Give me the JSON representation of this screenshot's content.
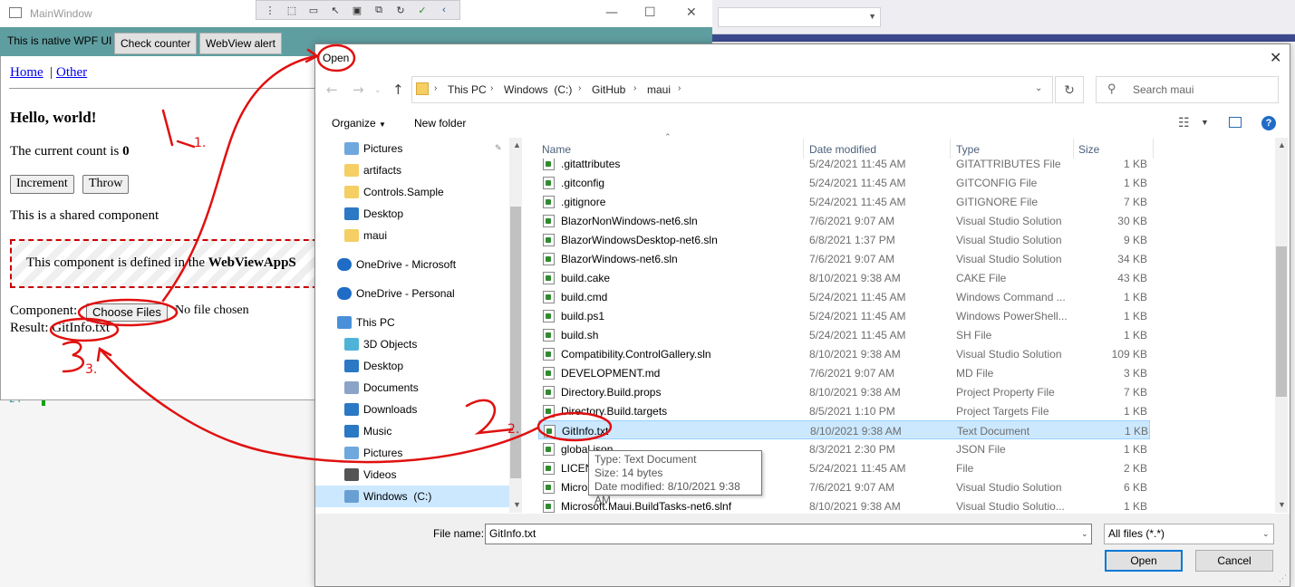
{
  "wpf": {
    "window_title": "MainWindow",
    "native_label": "This is native WPF UI",
    "check_counter_label": "Check counter",
    "webview_alert_label": "WebView alert"
  },
  "webview": {
    "nav_home": "Home",
    "nav_sep": "|",
    "nav_other": "Other",
    "heading": "Hello, world!",
    "count_prefix": "The current count is ",
    "count_value": "0",
    "increment_label": "Increment",
    "throw_label": "Throw",
    "shared_text": "This is a shared component",
    "defined_text": "This component is defined in the ",
    "defined_bold": "WebViewAppS",
    "component_label": "Component:",
    "choose_files_label": "Choose Files",
    "no_file_text": "No file chosen",
    "result_label": "Result:",
    "result_value": "GitInfo.txt"
  },
  "vs": {
    "line_number": "24"
  },
  "dialog": {
    "title": "Open",
    "breadcrumbs": [
      "This PC",
      "Windows  (C:)",
      "GitHub",
      "maui"
    ],
    "search_placeholder": "Search maui",
    "organize_label": "Organize",
    "new_folder_label": "New folder",
    "nav_items": [
      {
        "label": "Pictures",
        "icon": "pictures-icon"
      },
      {
        "label": "artifacts",
        "icon": "folder-icon"
      },
      {
        "label": "Controls.Sample",
        "icon": "folder-error-icon"
      },
      {
        "label": "Desktop",
        "icon": "desktop-icon"
      },
      {
        "label": "maui",
        "icon": "folder-error-icon"
      },
      {
        "label": "OneDrive - Microsoft",
        "icon": "onedrive-icon"
      },
      {
        "label": "OneDrive - Personal",
        "icon": "onedrive-error-icon"
      },
      {
        "label": "This PC",
        "icon": "computer-icon"
      },
      {
        "label": "3D Objects",
        "icon": "3d-objects-icon"
      },
      {
        "label": "Desktop",
        "icon": "desktop-icon"
      },
      {
        "label": "Documents",
        "icon": "documents-icon"
      },
      {
        "label": "Downloads",
        "icon": "downloads-icon"
      },
      {
        "label": "Music",
        "icon": "music-icon"
      },
      {
        "label": "Pictures",
        "icon": "pictures-icon"
      },
      {
        "label": "Videos",
        "icon": "videos-icon"
      },
      {
        "label": "Windows  (C:)",
        "icon": "drive-icon"
      }
    ],
    "columns": {
      "name": "Name",
      "date": "Date modified",
      "type": "Type",
      "size": "Size"
    },
    "files": [
      {
        "name": ".gitattributes",
        "date": "5/24/2021 11:45 AM",
        "type": "GITATTRIBUTES File",
        "size": "1 KB"
      },
      {
        "name": ".gitconfig",
        "date": "5/24/2021 11:45 AM",
        "type": "GITCONFIG File",
        "size": "1 KB"
      },
      {
        "name": ".gitignore",
        "date": "5/24/2021 11:45 AM",
        "type": "GITIGNORE File",
        "size": "7 KB"
      },
      {
        "name": "BlazorNonWindows-net6.sln",
        "date": "7/6/2021 9:07 AM",
        "type": "Visual Studio Solution",
        "size": "30 KB"
      },
      {
        "name": "BlazorWindowsDesktop-net6.sln",
        "date": "6/8/2021 1:37 PM",
        "type": "Visual Studio Solution",
        "size": "9 KB"
      },
      {
        "name": "BlazorWindows-net6.sln",
        "date": "7/6/2021 9:07 AM",
        "type": "Visual Studio Solution",
        "size": "34 KB"
      },
      {
        "name": "build.cake",
        "date": "8/10/2021 9:38 AM",
        "type": "CAKE File",
        "size": "43 KB"
      },
      {
        "name": "build.cmd",
        "date": "5/24/2021 11:45 AM",
        "type": "Windows Command ...",
        "size": "1 KB"
      },
      {
        "name": "build.ps1",
        "date": "5/24/2021 11:45 AM",
        "type": "Windows PowerShell...",
        "size": "1 KB"
      },
      {
        "name": "build.sh",
        "date": "5/24/2021 11:45 AM",
        "type": "SH File",
        "size": "1 KB"
      },
      {
        "name": "Compatibility.ControlGallery.sln",
        "date": "8/10/2021 9:38 AM",
        "type": "Visual Studio Solution",
        "size": "109 KB"
      },
      {
        "name": "DEVELOPMENT.md",
        "date": "7/6/2021 9:07 AM",
        "type": "MD File",
        "size": "3 KB"
      },
      {
        "name": "Directory.Build.props",
        "date": "8/10/2021 9:38 AM",
        "type": "Project Property File",
        "size": "7 KB"
      },
      {
        "name": "Directory.Build.targets",
        "date": "8/5/2021 1:10 PM",
        "type": "Project Targets File",
        "size": "1 KB"
      },
      {
        "name": "GitInfo.txt",
        "date": "8/10/2021 9:38 AM",
        "type": "Text Document",
        "size": "1 KB",
        "selected": true
      },
      {
        "name": "global.json",
        "date": "8/3/2021 2:30 PM",
        "type": "JSON File",
        "size": "1 KB"
      },
      {
        "name": "LICENSE",
        "date": "5/24/2021 11:45 AM",
        "type": "File",
        "size": "2 KB"
      },
      {
        "name": "Microsoft.Maui-net6.sln",
        "date": "7/6/2021 9:07 AM",
        "type": "Visual Studio Solution",
        "size": "6 KB"
      },
      {
        "name": "Microsoft.Maui.BuildTasks-net6.slnf",
        "date": "8/10/2021 9:38 AM",
        "type": "Visual Studio Solutio...",
        "size": "1 KB"
      }
    ],
    "tooltip": [
      "Type: Text Document",
      "Size: 14 bytes",
      "Date modified: 8/10/2021 9:38 AM"
    ],
    "file_name_label": "File name:",
    "file_name_value": "GitInfo.txt",
    "file_type_value": "All files (*.*)",
    "open_label": "Open",
    "cancel_label": "Cancel"
  },
  "annotations": {
    "step1": "1.",
    "step2": "2.",
    "step3": "3."
  },
  "colors": {
    "accent": "#0078d7",
    "wpf_bar": "#5f9ea0",
    "selection": "#cce8ff",
    "annotation": "#e01010",
    "dashed_border": "#cc0000"
  }
}
